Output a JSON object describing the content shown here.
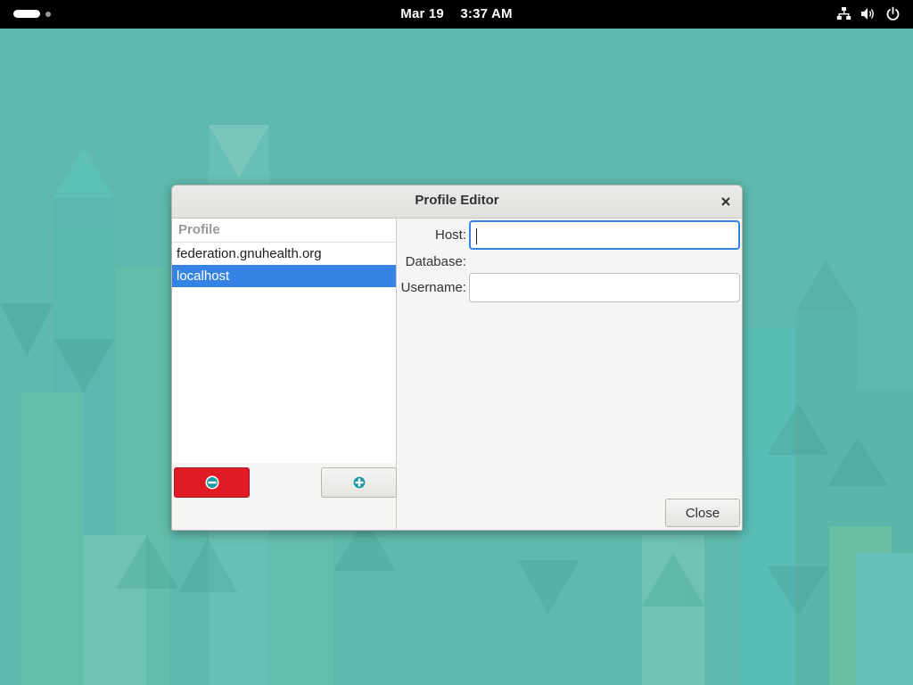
{
  "topbar": {
    "date": "Mar 19",
    "time": "3:37 AM",
    "icons": [
      "network-icon",
      "volume-icon",
      "power-icon"
    ]
  },
  "dialog": {
    "title": "Profile Editor",
    "profile_list": {
      "header": "Profile",
      "items": [
        {
          "label": "federation.gnuhealth.org",
          "selected": false
        },
        {
          "label": "localhost",
          "selected": true
        }
      ]
    },
    "buttons": {
      "remove_icon": "minus-circle-icon",
      "add_icon": "plus-circle-icon",
      "close_label": "Close"
    },
    "form": {
      "host_label": "Host:",
      "host_value": "",
      "database_label": "Database:",
      "username_label": "Username:",
      "username_value": ""
    }
  },
  "colors": {
    "desktop_bg": "#5fbaad",
    "selection": "#3584e4",
    "remove_button": "#e01b24",
    "add_icon": "#1c9aa6"
  }
}
